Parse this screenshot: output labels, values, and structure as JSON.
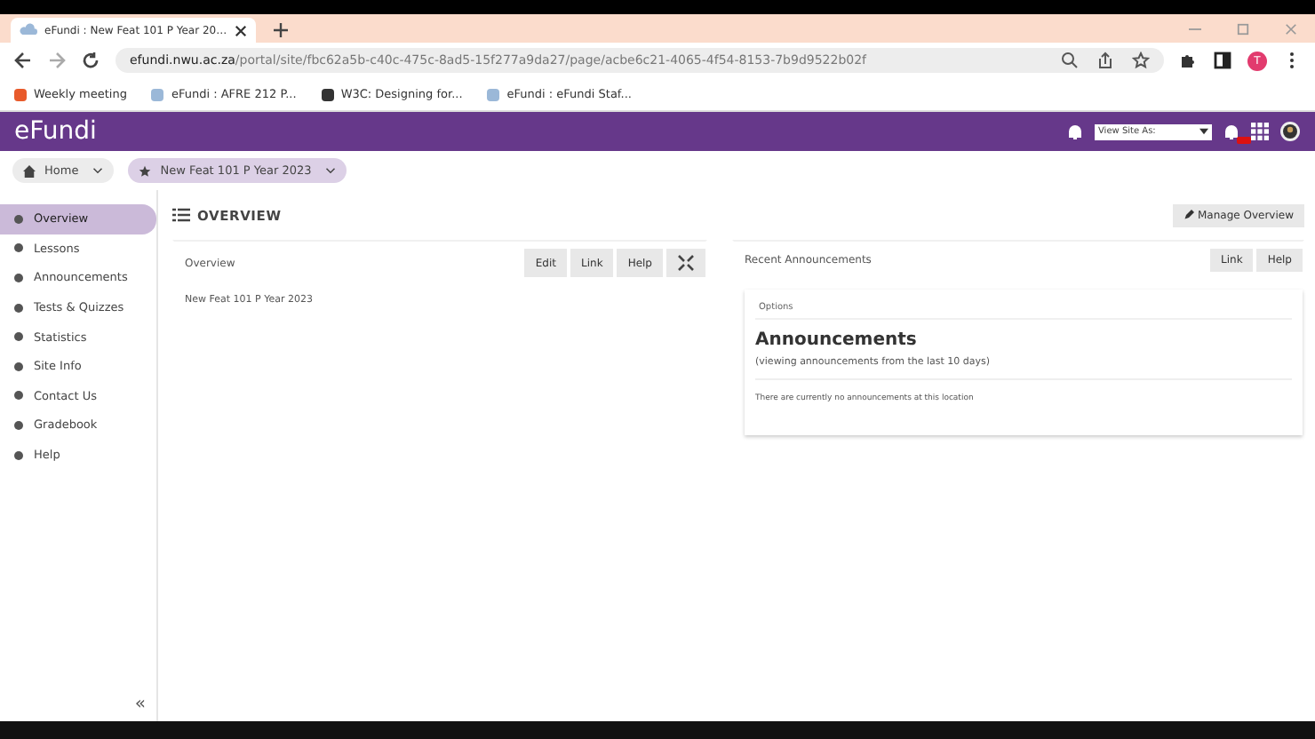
{
  "browser": {
    "tab_title": "eFundi : New Feat 101 P Year 20…",
    "url_host": "efundi.nwu.ac.za",
    "url_path": "/portal/site/fbc62a5b-c40c-475c-8ad5-15f277a9da27/page/acbe6c21-4065-4f54-8153-7b9d9522b02f",
    "profile_initial": "T",
    "bookmarks": [
      "Weekly meeting",
      "eFundi : AFRE 212 P...",
      "W3C: Designing for...",
      "eFundi : eFundi Staf..."
    ]
  },
  "header": {
    "logo": "eFundi",
    "view_site_as": "View Site As:"
  },
  "breadcrumbs": [
    {
      "label": "Home",
      "selected": false
    },
    {
      "label": "New Feat 101 P Year 2023",
      "selected": true
    }
  ],
  "sidebar": {
    "items": [
      {
        "label": "Overview",
        "selected": true
      },
      {
        "label": "Lessons",
        "selected": false
      },
      {
        "label": "Announcements",
        "selected": false
      },
      {
        "label": "Tests & Quizzes",
        "selected": false
      },
      {
        "label": "Statistics",
        "selected": false
      },
      {
        "label": "Site Info",
        "selected": false
      },
      {
        "label": "Contact Us",
        "selected": false
      },
      {
        "label": "Gradebook",
        "selected": false
      },
      {
        "label": "Help",
        "selected": false
      }
    ],
    "collapse": "«"
  },
  "page": {
    "title": "OVERVIEW",
    "manage_button": "Manage Overview"
  },
  "overview_panel": {
    "title": "Overview",
    "buttons": [
      "Edit",
      "Link",
      "Help"
    ],
    "body": "New Feat 101 P Year 2023"
  },
  "announcements_panel": {
    "title": "Recent Announcements",
    "buttons": [
      "Link",
      "Help"
    ],
    "options": "Options",
    "heading": "Announcements",
    "subheading": "(viewing announcements from the last 10 days)",
    "empty": "There are currently no announcements at this location"
  }
}
